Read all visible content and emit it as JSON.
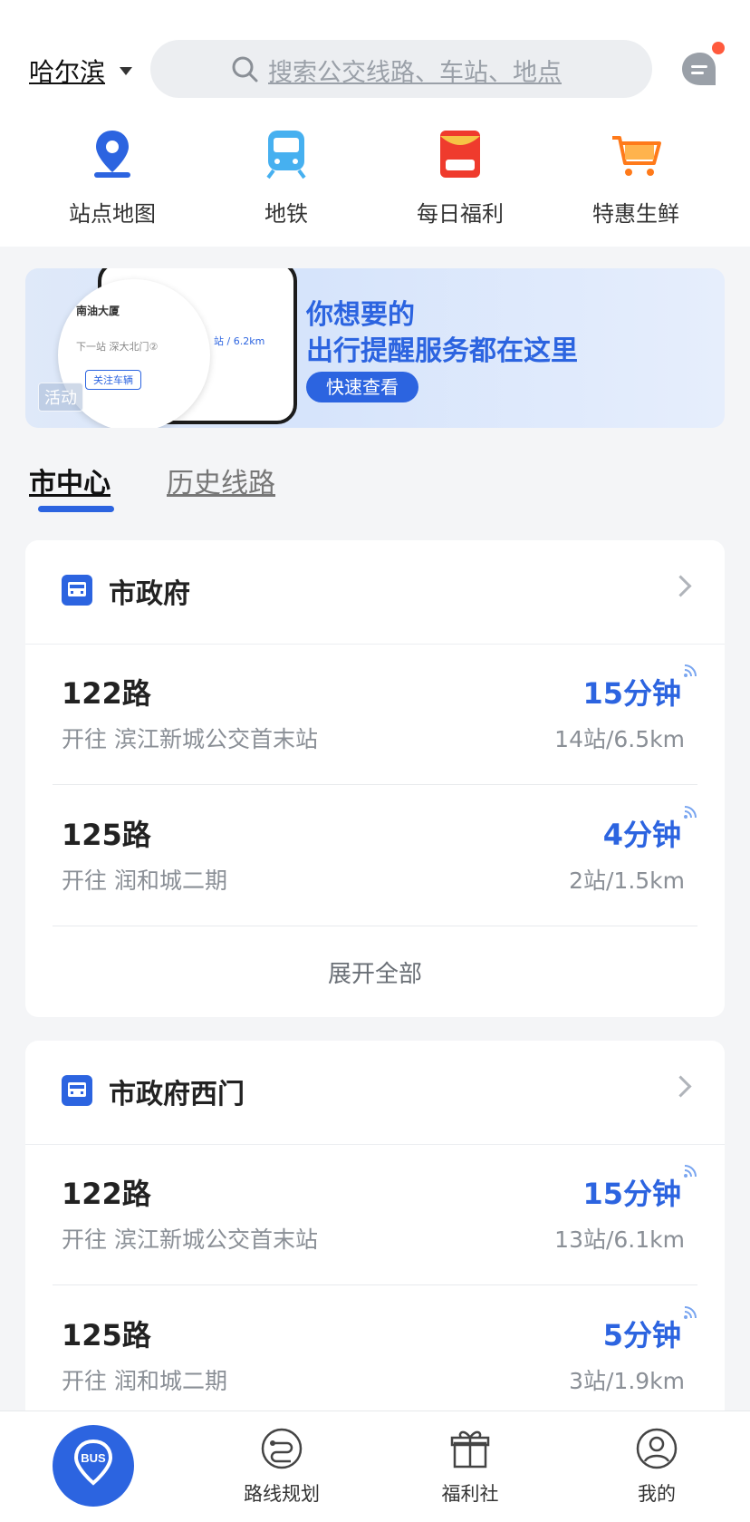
{
  "header": {
    "city": "哈尔滨",
    "search_placeholder": "搜索公交线路、车站、地点"
  },
  "quick_actions": [
    {
      "label": "站点地图",
      "icon": "map-pin-icon"
    },
    {
      "label": "地铁",
      "icon": "subway-icon"
    },
    {
      "label": "每日福利",
      "icon": "red-packet-icon"
    },
    {
      "label": "特惠生鲜",
      "icon": "shopping-cart-icon"
    }
  ],
  "banner": {
    "line1": "你想要的",
    "line2": "出行提醒服务都在这里",
    "button": "快速查看",
    "tag": "活动",
    "preview_station": "南油大厦",
    "preview_next": "下一站 深大北门②",
    "preview_follow": "关注车辆",
    "preview_dist": "站 / 6.2km"
  },
  "tabs": {
    "active": "市中心",
    "inactive": "历史线路"
  },
  "stations": [
    {
      "name": "市政府",
      "routes": [
        {
          "name": "122路",
          "direction": "开往 滨江新城公交首末站",
          "eta": "15分钟",
          "distance": "14站/6.5km"
        },
        {
          "name": "125路",
          "direction": "开往 润和城二期",
          "eta": "4分钟",
          "distance": "2站/1.5km"
        }
      ],
      "expand_label": "展开全部"
    },
    {
      "name": "市政府西门",
      "routes": [
        {
          "name": "122路",
          "direction": "开往 滨江新城公交首末站",
          "eta": "15分钟",
          "distance": "13站/6.1km"
        },
        {
          "name": "125路",
          "direction": "开往 润和城二期",
          "eta": "5分钟",
          "distance": "3站/1.9km"
        }
      ]
    }
  ],
  "bottom_nav": [
    {
      "label": "BUS",
      "icon": "bus-pin-icon"
    },
    {
      "label": "路线规划",
      "icon": "route-icon"
    },
    {
      "label": "福利社",
      "icon": "gift-icon"
    },
    {
      "label": "我的",
      "icon": "profile-icon"
    }
  ],
  "colors": {
    "accent": "#2c64e0",
    "notification": "#ff5a3d"
  }
}
